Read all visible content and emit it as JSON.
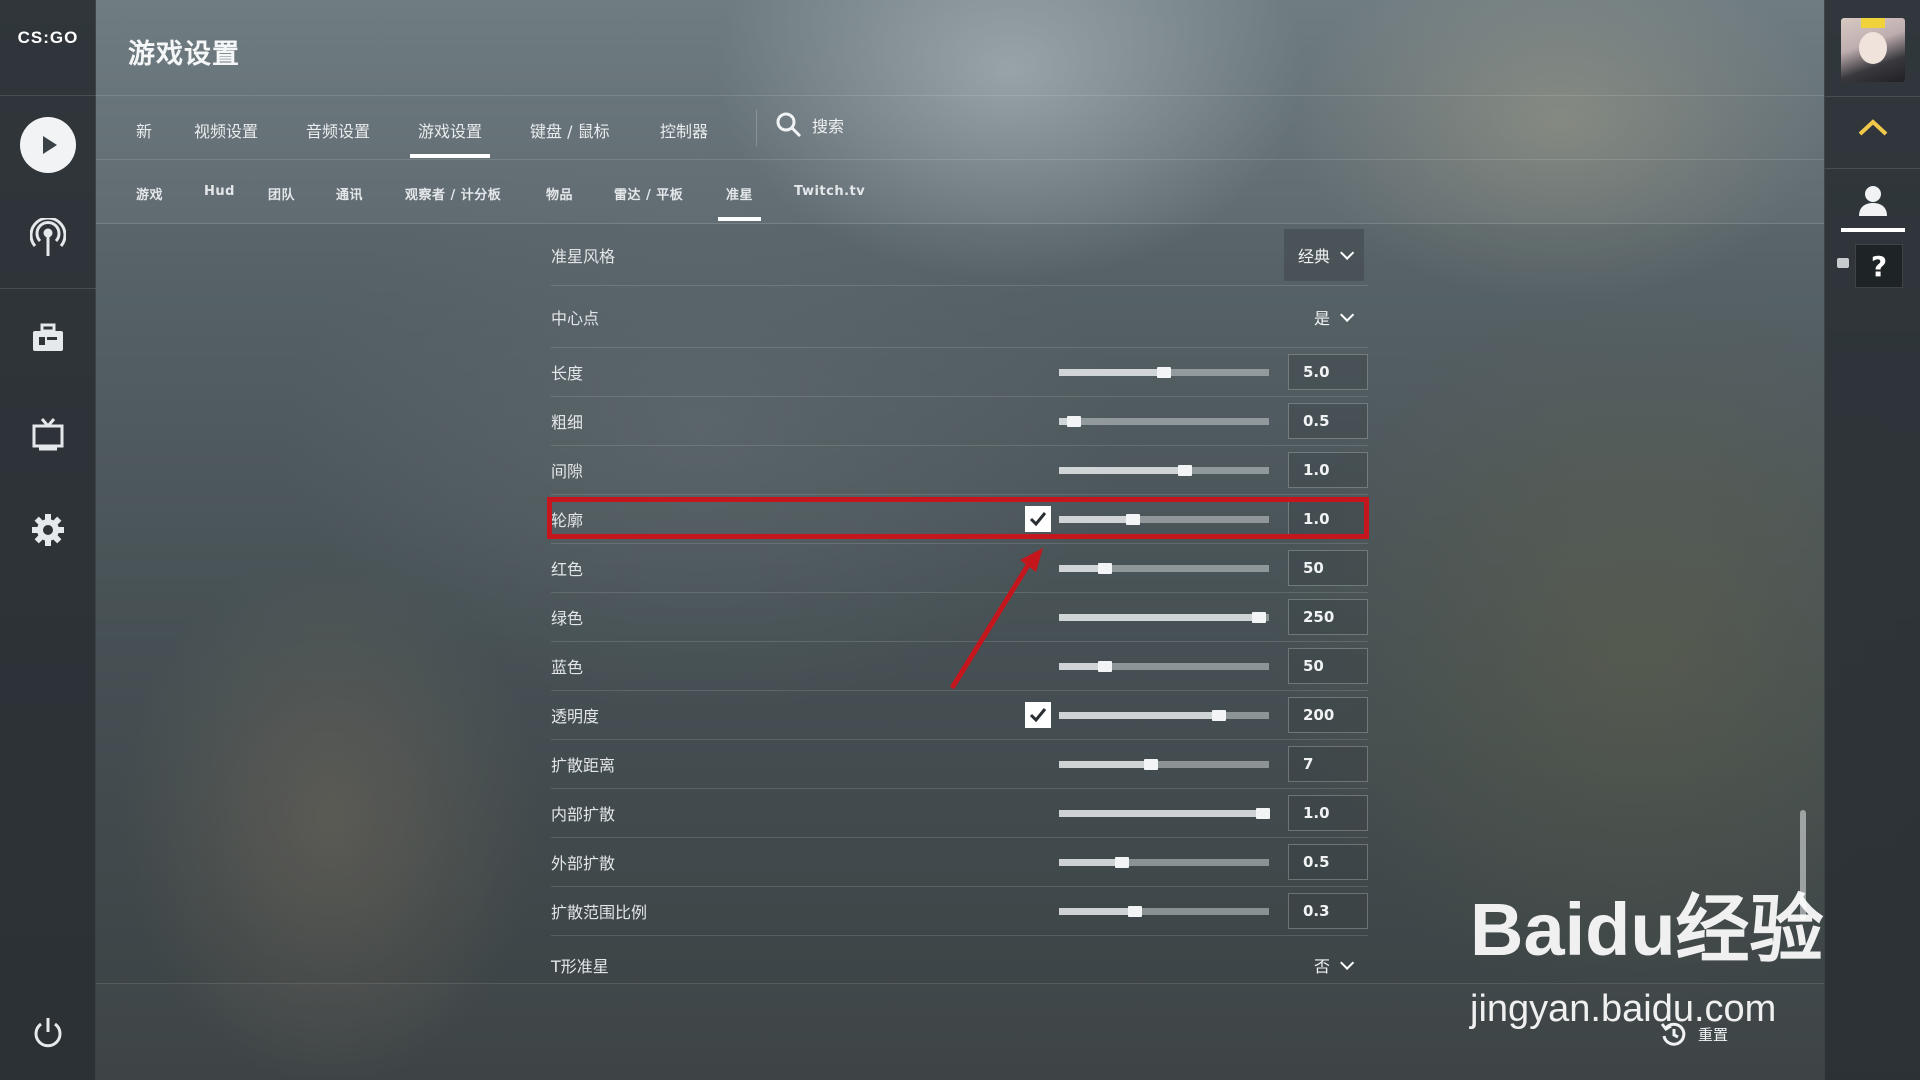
{
  "app": {
    "logo": "CS:GO",
    "title": "游戏设置"
  },
  "tabs": [
    {
      "label": "新"
    },
    {
      "label": "视频设置"
    },
    {
      "label": "音频设置"
    },
    {
      "label": "游戏设置",
      "active": true
    },
    {
      "label": "键盘 / 鼠标"
    },
    {
      "label": "控制器"
    }
  ],
  "search": {
    "label": "搜索"
  },
  "subtabs": [
    {
      "label": "游戏"
    },
    {
      "label": "Hud"
    },
    {
      "label": "团队"
    },
    {
      "label": "通讯"
    },
    {
      "label": "观察者 / 计分板"
    },
    {
      "label": "物品"
    },
    {
      "label": "雷达 / 平板"
    },
    {
      "label": "准星",
      "active": true
    },
    {
      "label": "Twitch.tv"
    }
  ],
  "settings": {
    "crosshair_style": {
      "label": "准星风格",
      "value": "经典"
    },
    "center_dot": {
      "label": "中心点",
      "value": "是"
    },
    "sliders": [
      {
        "label": "长度",
        "value": "5.0",
        "fraction": 0.5,
        "checkbox": false
      },
      {
        "label": "粗细",
        "value": "0.5",
        "fraction": 0.07,
        "checkbox": false
      },
      {
        "label": "间隙",
        "value": "1.0",
        "fraction": 0.6,
        "checkbox": false
      },
      {
        "label": "轮廓",
        "value": "1.0",
        "fraction": 0.35,
        "checkbox": true,
        "checked": true,
        "highlighted": true
      },
      {
        "label": "红色",
        "value": "50",
        "fraction": 0.22,
        "checkbox": false
      },
      {
        "label": "绿色",
        "value": "250",
        "fraction": 0.95,
        "checkbox": false
      },
      {
        "label": "蓝色",
        "value": "50",
        "fraction": 0.22,
        "checkbox": false
      },
      {
        "label": "透明度",
        "value": "200",
        "fraction": 0.76,
        "checkbox": true,
        "checked": true
      },
      {
        "label": "扩散距离",
        "value": "7",
        "fraction": 0.44,
        "checkbox": false
      },
      {
        "label": "内部扩散",
        "value": "1.0",
        "fraction": 0.97,
        "checkbox": false
      },
      {
        "label": "外部扩散",
        "value": "0.5",
        "fraction": 0.3,
        "checkbox": false
      },
      {
        "label": "扩散范围比例",
        "value": "0.3",
        "fraction": 0.36,
        "checkbox": false
      }
    ],
    "t_style": {
      "label": "T形准星",
      "value": "否"
    }
  },
  "footer": {
    "reset_label": "重置"
  },
  "watermark": {
    "main": "Baidu经验",
    "sub": "jingyan.baidu.com"
  },
  "colors": {
    "highlight": "#c4161c",
    "arrow": "#c4161c",
    "accent": "#ffffff"
  },
  "icons": [
    "play-icon",
    "broadcast-icon",
    "inventory-icon",
    "tv-icon",
    "gear-icon",
    "power-icon",
    "chevron-up-icon",
    "user-icon",
    "help-icon",
    "search-icon",
    "reset-icon",
    "check-icon",
    "chevron-down-icon"
  ]
}
